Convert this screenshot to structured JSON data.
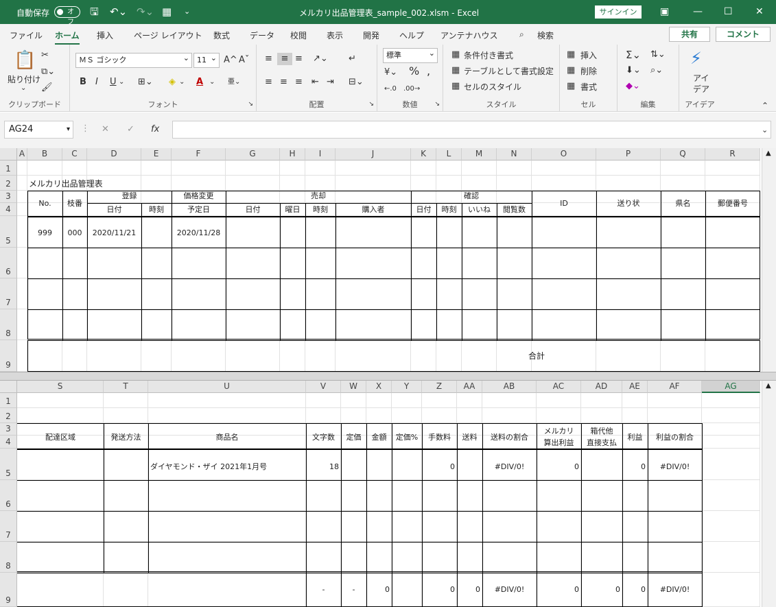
{
  "titlebar": {
    "autosave": "自動保存",
    "toggle": "オフ",
    "title": "メルカリ出品管理表_sample_002.xlsm  -  Excel",
    "signin": "サインイン"
  },
  "tabs": [
    "ファイル",
    "ホーム",
    "挿入",
    "ページ レイアウト",
    "数式",
    "データ",
    "校閲",
    "表示",
    "開発",
    "ヘルプ",
    "アンテナハウス",
    "検索"
  ],
  "share": "共有",
  "comment": "コメント",
  "ribbon": {
    "paste": "貼り付け",
    "clipboard": "クリップボード",
    "font_name": "ＭＳ ゴシック",
    "font_size": "11",
    "font": "フォント",
    "bold": "B",
    "italic": "I",
    "underline": "U",
    "alignment": "配置",
    "numfmt": "標準",
    "number": "数値",
    "cond": "条件付き書式",
    "table": "テーブルとして書式設定",
    "cellstyle": "セルのスタイル",
    "styles": "スタイル",
    "insert": "挿入",
    "delete": "削除",
    "format": "書式",
    "cells": "セル",
    "editing": "編集",
    "ideas_1": "アイ",
    "ideas_2": "デア",
    "ideas": "アイデア"
  },
  "namebox": "AG24",
  "colors": {
    "brand": "#217346",
    "header": "#e6e6e6"
  },
  "top": {
    "cols": [
      "A",
      "B",
      "C",
      "D",
      "E",
      "F",
      "G",
      "H",
      "I",
      "J",
      "K",
      "L",
      "M",
      "N",
      "O",
      "P",
      "Q",
      "R"
    ],
    "rows": [
      "1",
      "2",
      "3",
      "4",
      "5",
      "6",
      "7",
      "8",
      "9"
    ],
    "title": "メルカリ出品管理表",
    "h": {
      "no": "No.",
      "eda": "枝番",
      "touroku": "登録",
      "kakaku": "価格変更",
      "baikyaku": "売却",
      "kakunin": "確認",
      "hiduke": "日付",
      "jikoku": "時刻",
      "yotei": "予定日",
      "youbi": "曜日",
      "kounyu": "購入者",
      "iine": "いいね",
      "etsuran": "閲覧数",
      "id": "ID",
      "okuri": "送り状",
      "ken": "県名",
      "yubin": "郵便番号"
    },
    "r5": {
      "no": "999",
      "eda": "000",
      "date": "2020/11/21",
      "yotei": "2020/11/28"
    },
    "total": "合計"
  },
  "bottom": {
    "cols": [
      "S",
      "T",
      "U",
      "V",
      "W",
      "X",
      "Y",
      "Z",
      "AA",
      "AB",
      "AC",
      "AD",
      "AE",
      "AF",
      "AG"
    ],
    "rows": [
      "1",
      "2",
      "3",
      "4",
      "5",
      "6",
      "7",
      "8",
      "9"
    ],
    "h": {
      "haisou": "配達区域",
      "hassou": "発送方法",
      "shouhin": "商品名",
      "moji": "文字数",
      "teika": "定価",
      "kingaku": "金額",
      "teikap": "定価%",
      "tesuu": "手数料",
      "souryou": "送料",
      "souwari": "送料の割合",
      "meru1": "メルカリ",
      "meru2": "算出利益",
      "hako1": "箱代他",
      "hako2": "直接支払",
      "rieki": "利益",
      "riekiwari": "利益の割合"
    },
    "r5": {
      "name": "ダイヤモンド・ザイ 2021年1月号",
      "moji": "18",
      "tesuu": "0",
      "souwari": "#DIV/0!",
      "meru": "0",
      "rieki": "0",
      "riekiwari": "#DIV/0!"
    },
    "r9": {
      "moji": "-",
      "teika": "-",
      "kingaku": "0",
      "tesuu": "0",
      "souryou": "0",
      "souwari": "#DIV/0!",
      "meru": "0",
      "hako": "0",
      "rieki": "0",
      "riekiwari": "#DIV/0!"
    }
  }
}
